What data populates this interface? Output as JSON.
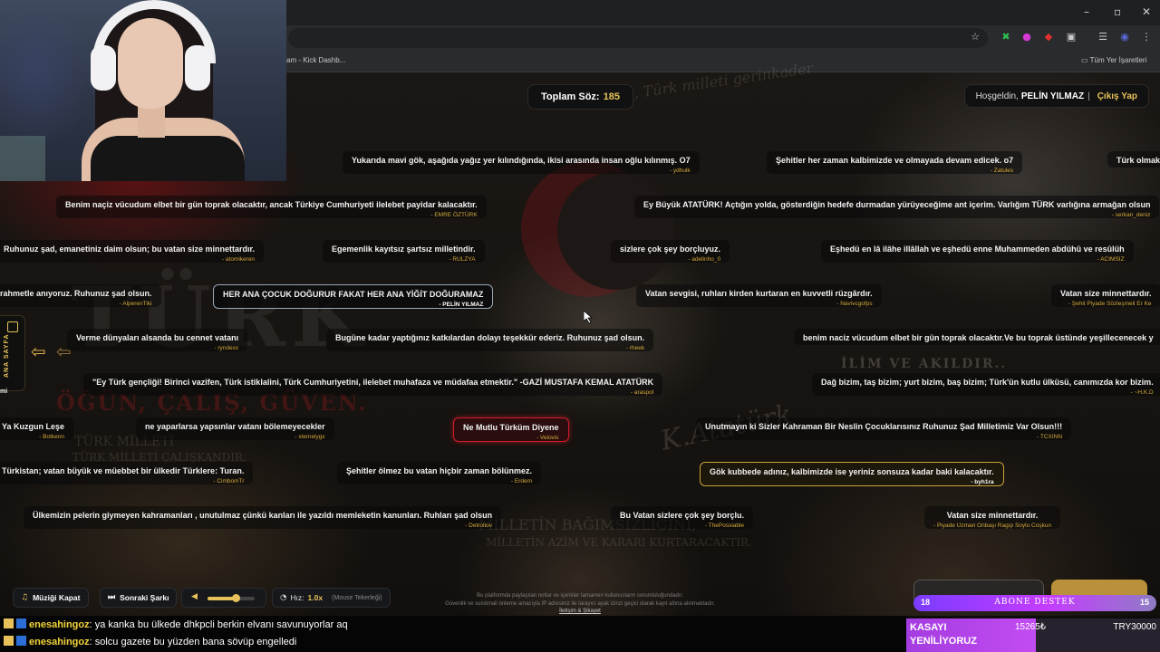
{
  "browser": {
    "tab_partial": "am - Kick Dashb...",
    "bookmark_right": "Tüm Yer İşaretleri"
  },
  "header": {
    "counter_label": "Toplam Söz:",
    "counter_value": "185",
    "welcome_text": "Hoşgeldin,",
    "username": "PELİN YILMAZ",
    "separator": "|",
    "logout_label": "Çıkış Yap"
  },
  "sidenav": {
    "label": "ANA SAYFA"
  },
  "quotes": [
    {
      "text": "Yukarıda mavi gök, aşağıda yağız yer kılındığında, ikisi arasında insan oğlu kılınmış. O7",
      "author": "- ydhulk"
    },
    {
      "text": "Şehitler her zaman kalbimizde ve olmayada devam edicek. o7",
      "author": "- Zatules"
    },
    {
      "text": "Türk olmak",
      "author": ""
    },
    {
      "text": "Benim naçiz vücudum elbet bir gün toprak olacaktır, ancak Türkiye Cumhuriyeti ilelebet payidar kalacaktır.",
      "author": "- EMRE ÖZTÜRK"
    },
    {
      "text": "Ey Büyük ATATÜRK! Açtığın yolda, gösterdiğin hedefe durmadan yürüyeceğime ant içerim. Varlığım TÜRK varlığına armağan olsun",
      "author": "- serkan_deniz"
    },
    {
      "text": "Ruhunuz şad, emanetiniz daim olsun; bu vatan size minnettardır.",
      "author": "- atomikeren"
    },
    {
      "text": "Egemenlik kayıtsız şartsız milletindir.",
      "author": "- RULZYA"
    },
    {
      "text": "sizlere çok şey borçluyuz.",
      "author": "- adelinho_0"
    },
    {
      "text": "Eşhedü en lâ ilâhe illâllah ve eşhedü enne Muhammeden abdühû ve resûlüh",
      "author": "- ACIMSIZ"
    },
    {
      "text": "rahmetle anıyoruz. Ruhunuz şad olsun.",
      "author": "- AlperenTiki"
    },
    {
      "text": "HER ANA ÇOCUK DOĞURUR FAKAT HER ANA YİĞİT DOĞURAMAZ",
      "author": "- PELİN YILMAZ"
    },
    {
      "text": "Vatan sevgisi, ruhları kirden kurtaran en kuvvetli rüzgârdır.",
      "author": "- Navivcgofps"
    },
    {
      "text": "Vatan size minnettardır.",
      "author": "- Şehit Piyade Sözleşmeli Er Ke"
    },
    {
      "text": "Verme dünyaları alsanda bu cennet vatanı",
      "author": "- ryndexx"
    },
    {
      "text": "Bugüne kadar yaptığınız katkılardan dolayı teşekkür ederiz. Ruhunuz şad olsun.",
      "author": "- rheek"
    },
    {
      "text": "benim naciz vücudum elbet bir gün toprak olacaktır.Ve bu toprak üstünde yeşillecenecek y",
      "author": ""
    },
    {
      "text": "\"Ey Türk gençliği! Birinci vazifen, Türk istiklalini, Türk Cumhuriyetini, ilelebet muhafaza ve müdafaa etmektir.\" -GAZİ MUSTAFA KEMAL ATATÜRK",
      "author": "- araspol"
    },
    {
      "text": "Dağ bizim, taş bizim; yurt bizim, baş bizim; Türk'ün kutlu ülküsü, canımızda kor bizim.",
      "author": "- ~H.K.D"
    },
    {
      "text": "mi",
      "author": ""
    },
    {
      "text": "Ya Kuzgun Leşe",
      "author": "- Botkenn"
    },
    {
      "text": "ne yaparlarsa yapsınlar vatanı bölemeyecekler",
      "author": "- xtemelygx"
    },
    {
      "text": "Ne Mutlu Türküm Diyene",
      "author": "- Velovis"
    },
    {
      "text": "Unutmayın ki Sizler Kahraman Bir Neslin Çocuklarısınız Ruhunuz Şad Milletimiz Var Olsun!!!",
      "author": "- TCXINN"
    },
    {
      "text": "Türkistan; vatan büyük ve müebbet bir ülkedir Türklere: Turan.",
      "author": "- CimbomTr"
    },
    {
      "text": "Şehitler ölmez bu vatan hiçbir zaman bölünmez.",
      "author": "- Erdem"
    },
    {
      "text": "Gök kubbede adınız, kalbimizde ise yeriniz sonsuza kadar baki kalacaktır.",
      "author": "- byh1ra"
    },
    {
      "text": "Ülkemizin pelerin giymeyen kahramanları , unutulmaz çünkü kanları ile yazıldı memleketin kanunları. Ruhları şad olsun",
      "author": "- Detroitov"
    },
    {
      "text": "Bu Vatan sizlere çok şey borçlu.",
      "author": "- ThePossiable"
    },
    {
      "text": "Vatan size minnettardır.",
      "author": "- Piyade Uzman Onbaşı Ragıp Soylu Coşkun"
    }
  ],
  "controls": {
    "music_off": "Müziği Kapat",
    "next_song": "Sonraki Şarkı",
    "volume_percent": 60,
    "speed_label": "Hız:",
    "speed_value": "1.0x",
    "speed_hint": "(Mouse Tekerleği)"
  },
  "disclaimer": {
    "line1": "Bu platformda paylaşılan notlar ve içerikler tamamen kullanıcıların sorumluluğundadır.",
    "line2": "Güvenlik ve suistimali önleme amacıyla IP adresiniz ile tarayıcı ayak izinzi geçici olarak kayıt altına alınmaktadır.",
    "link": "İletişim & Şikayet"
  },
  "chat": [
    {
      "user": "enesahingoz",
      "message": ": ya kanka bu ülkede dhkpcli berkin elvanı savunuyorlar aq"
    },
    {
      "user": "enesahingoz",
      "message": ": solcu gazete bu yüzden bana sövüp engelledi"
    }
  ],
  "sub_goal": {
    "left": "18",
    "label": "ABONE DESTEK",
    "right": "15"
  },
  "kasa": {
    "title_line1": "KASAYI",
    "title_line2": "YENİLİYORUZ",
    "current": "15265₺",
    "goal": "TRY30000",
    "progress": 0.51
  },
  "colors": {
    "accent_gold": "#e7c25a",
    "highlight_red": "#d11a2a",
    "sub_purple": "#a43ce0"
  }
}
